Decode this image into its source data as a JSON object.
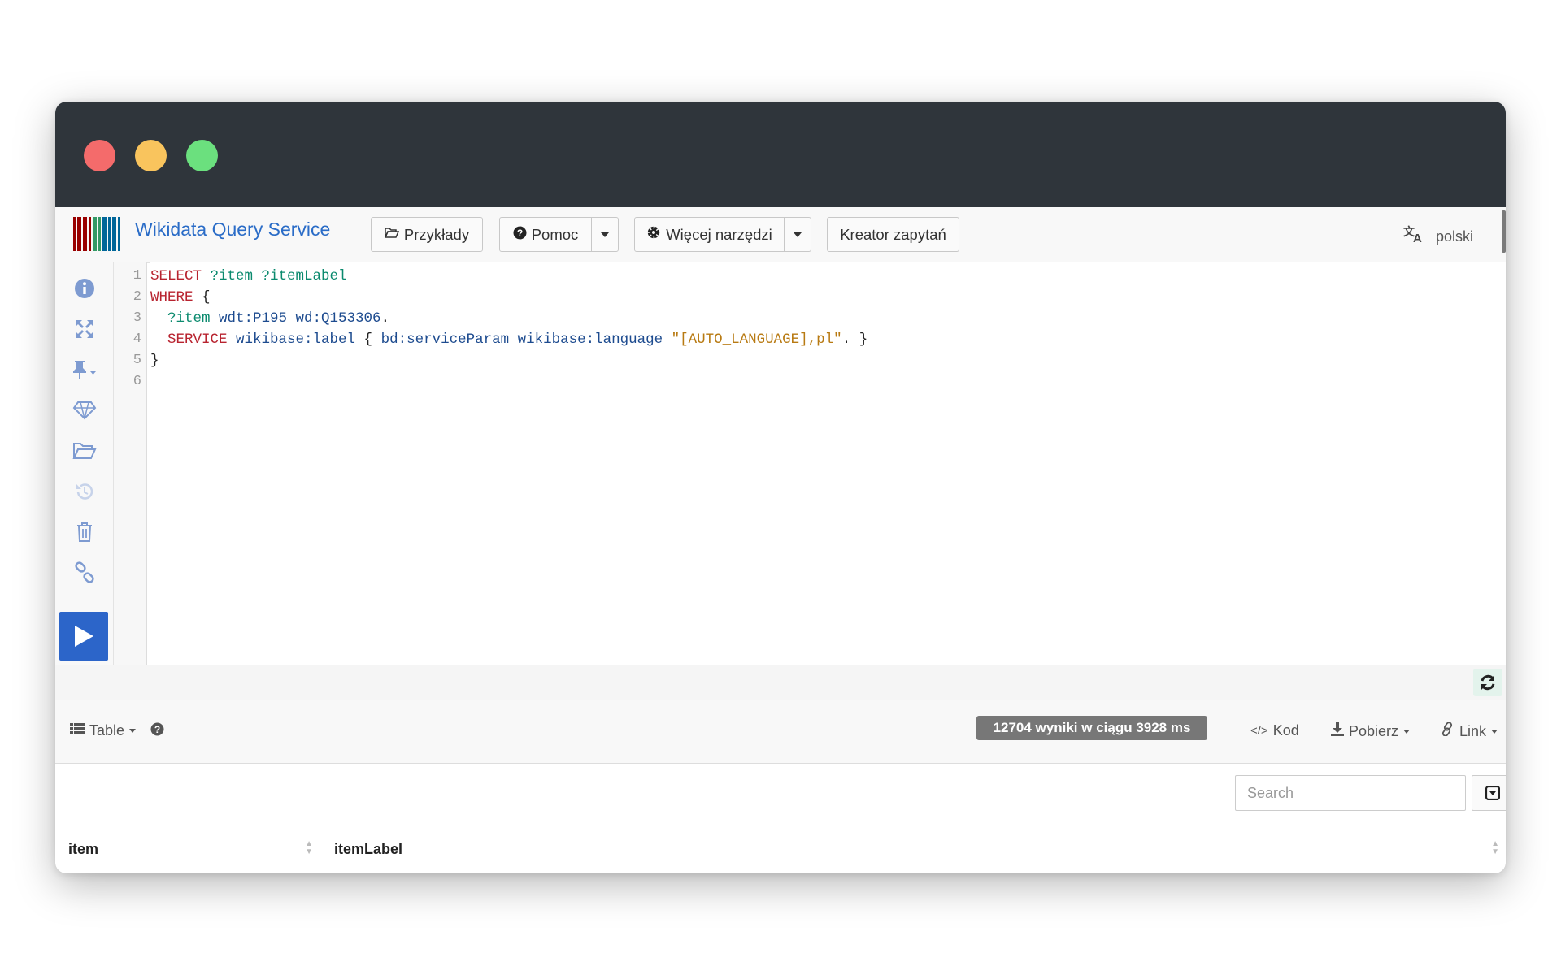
{
  "app": {
    "brand": "Wikidata Query Service",
    "language": "polski"
  },
  "toolbar": {
    "examples": "Przykłady",
    "help": "Pomoc",
    "more_tools": "Więcej narzędzi",
    "query_builder": "Kreator zapytań"
  },
  "editor": {
    "line_numbers": [
      "1",
      "2",
      "3",
      "4",
      "5",
      "6"
    ],
    "lines": [
      {
        "kw1": "SELECT",
        "v1": " ?item ?itemLabel"
      },
      {
        "kw1": "WHERE",
        "rest": " {"
      },
      {
        "v1": "  ?item",
        "iri": " wdt:P195 wd:Q153306",
        "rest": "."
      },
      {
        "kw1": "  SERVICE",
        "iri": " wikibase:label",
        "rest1": " { ",
        "iri2": "bd:serviceParam wikibase:language",
        "rest2": " ",
        "str": "\"[AUTO_LANGUAGE],pl\"",
        "rest3": ". }"
      },
      {
        "rest": "}"
      },
      {}
    ]
  },
  "sidebar": {
    "icons": [
      "info-icon",
      "expand-icon",
      "pin-icon",
      "diamond-icon",
      "folder-open-icon",
      "history-icon",
      "trash-icon",
      "link-icon"
    ]
  },
  "results": {
    "view": "Table",
    "summary": "12704 wyniki w ciągu 3928 ms",
    "code": "Kod",
    "download": "Pobierz",
    "link": "Link",
    "search_placeholder": "Search",
    "columns": [
      "item",
      "itemLabel"
    ]
  },
  "colors": {
    "accent": "#2c65c9",
    "brand_text": "#2a6cc7",
    "titlebar": "#2f353b"
  }
}
